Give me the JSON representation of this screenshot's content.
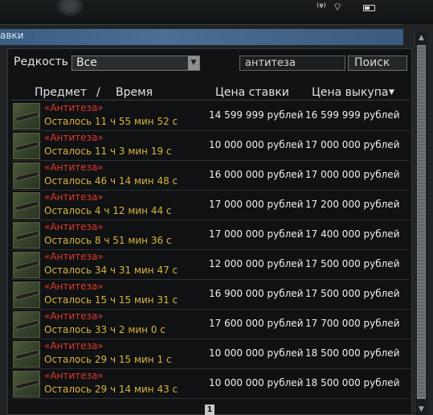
{
  "window": {
    "title_fragment": "авки"
  },
  "filters": {
    "rarity_label": "Редкость",
    "rarity_value": "Все",
    "search_value": "антитеза",
    "search_button": "Поиск"
  },
  "table": {
    "headers": {
      "item": "Предмет",
      "separator": "/",
      "time": "Время",
      "bid": "Цена ставки",
      "buyout": "Цена выкупа"
    },
    "rows": [
      {
        "name": "«Антитеза»",
        "time": "Осталось 11 ч 55 мин 52 с",
        "bid": "14 599 999 рублей",
        "buyout": "16 599 999 рублей"
      },
      {
        "name": "«Антитеза»",
        "time": "Осталось 11 ч 3 мин 19 с",
        "bid": "10 000 000 рублей",
        "buyout": "17 000 000 рублей"
      },
      {
        "name": "«Антитеза»",
        "time": "Осталось 46 ч 14 мин 48 с",
        "bid": "16 000 000 рублей",
        "buyout": "17 000 000 рублей"
      },
      {
        "name": "«Антитеза»",
        "time": "Осталось 4 ч 12 мин 44 с",
        "bid": "17 000 000 рублей",
        "buyout": "17 200 000 рублей"
      },
      {
        "name": "«Антитеза»",
        "time": "Осталось 8 ч 51 мин 36 с",
        "bid": "17 000 000 рублей",
        "buyout": "17 400 000 рублей"
      },
      {
        "name": "«Антитеза»",
        "time": "Осталось 34 ч 31 мин 47 с",
        "bid": "12 000 000 рублей",
        "buyout": "17 500 000 рублей"
      },
      {
        "name": "«Антитеза»",
        "time": "Осталось 15 ч 15 мин 31 с",
        "bid": "16 900 000 рублей",
        "buyout": "17 500 000 рублей"
      },
      {
        "name": "«Антитеза»",
        "time": "Осталось 33 ч 2 мин 0 с",
        "bid": "17 600 000 рублей",
        "buyout": "17 700 000 рублей"
      },
      {
        "name": "«Антитеза»",
        "time": "Осталось 29 ч 15 мин 1 с",
        "bid": "10 000 000 рублей",
        "buyout": "18 500 000 рублей"
      },
      {
        "name": "«Антитеза»",
        "time": "Осталось 29 ч 14 мин 43 с",
        "bid": "10 000 000 рублей",
        "buyout": "18 500 000 рублей"
      }
    ]
  },
  "pagination": {
    "current_page": "1"
  },
  "icons": {
    "sort": "sort-descending-icon",
    "dropdown": "chevron-down-icon",
    "item": "rifle-icon"
  },
  "colors": {
    "item_name": "#e03a2c",
    "time_remaining": "#d9b53e",
    "title_bar": "#4b6e94"
  }
}
